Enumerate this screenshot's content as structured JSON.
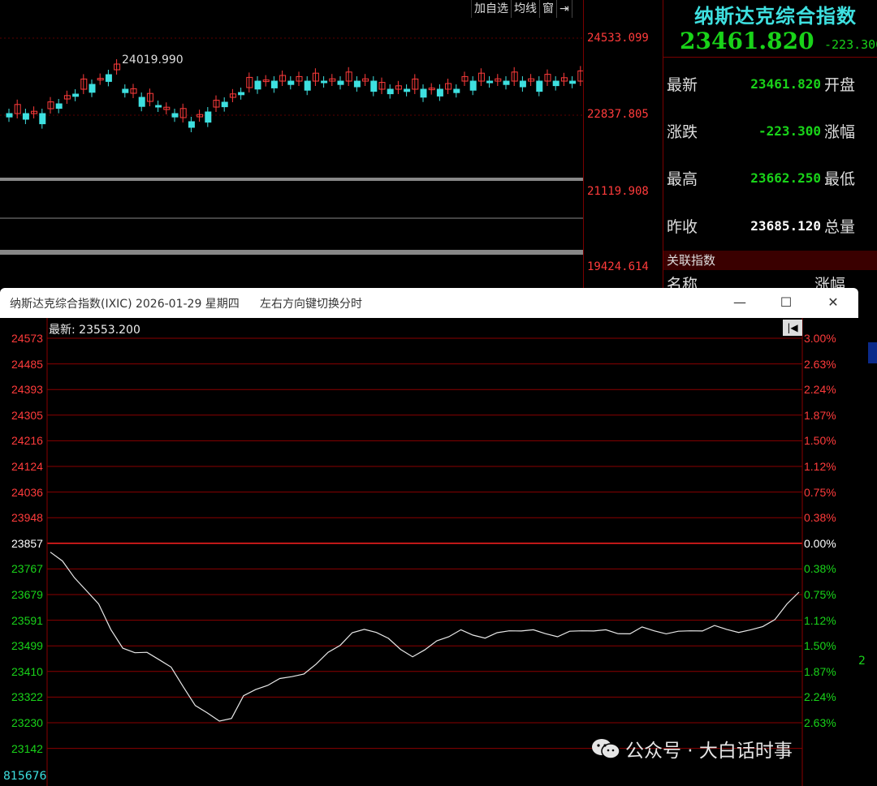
{
  "kline": {
    "toolbar": [
      "加自选",
      "均线",
      "窗",
      "⇥"
    ],
    "peak_label": "24019.990",
    "axis_labels": [
      "24533.099",
      "22837.805",
      "21119.908",
      "19424.614"
    ]
  },
  "quote": {
    "title": "纳斯达克综合指数",
    "price": "23461.820",
    "change": "-223.300",
    "rows": [
      {
        "label": "最新",
        "value": "23461.820",
        "label2": "开盘",
        "color": "#19d319"
      },
      {
        "label": "涨跌",
        "value": "-223.300",
        "label2": "涨幅",
        "color": "#19d319"
      },
      {
        "label": "最高",
        "value": "23662.250",
        "label2": "最低",
        "color": "#19d319"
      },
      {
        "label": "昨收",
        "value": "23685.120",
        "label2": "总量",
        "color": "#ffffff"
      }
    ],
    "related_header": "关联指数",
    "related_col1": "名称",
    "related_col2": "涨幅"
  },
  "popup": {
    "title": "纳斯达克综合指数(IXIC) 2026-01-29 星期四",
    "hint": "左右方向键切换分时",
    "latest": "最新: 23553.200",
    "min_icon": "minimize-icon",
    "max_icon": "maximize-icon",
    "close_icon": "close-icon",
    "y_labels": [
      {
        "v": "24573",
        "c": "#ff3b3b"
      },
      {
        "v": "24485",
        "c": "#ff3b3b"
      },
      {
        "v": "24393",
        "c": "#ff3b3b"
      },
      {
        "v": "24305",
        "c": "#ff3b3b"
      },
      {
        "v": "24216",
        "c": "#ff3b3b"
      },
      {
        "v": "24124",
        "c": "#ff3b3b"
      },
      {
        "v": "24036",
        "c": "#ff3b3b"
      },
      {
        "v": "23948",
        "c": "#ff3b3b"
      },
      {
        "v": "23857",
        "c": "#ffffff"
      },
      {
        "v": "23767",
        "c": "#19d319"
      },
      {
        "v": "23679",
        "c": "#19d319"
      },
      {
        "v": "23591",
        "c": "#19d319"
      },
      {
        "v": "23499",
        "c": "#19d319"
      },
      {
        "v": "23410",
        "c": "#19d319"
      },
      {
        "v": "23322",
        "c": "#19d319"
      },
      {
        "v": "23230",
        "c": "#19d319"
      },
      {
        "v": "23142",
        "c": "#19d319"
      }
    ],
    "pct_labels": [
      {
        "v": "3.00%",
        "c": "#ff3b3b"
      },
      {
        "v": "2.63%",
        "c": "#ff3b3b"
      },
      {
        "v": "2.24%",
        "c": "#ff3b3b"
      },
      {
        "v": "1.87%",
        "c": "#ff3b3b"
      },
      {
        "v": "1.50%",
        "c": "#ff3b3b"
      },
      {
        "v": "1.12%",
        "c": "#ff3b3b"
      },
      {
        "v": "0.75%",
        "c": "#ff3b3b"
      },
      {
        "v": "0.38%",
        "c": "#ff3b3b"
      },
      {
        "v": "0.00%",
        "c": "#ffffff"
      },
      {
        "v": "0.38%",
        "c": "#19d319"
      },
      {
        "v": "0.75%",
        "c": "#19d319"
      },
      {
        "v": "1.12%",
        "c": "#19d319"
      },
      {
        "v": "1.50%",
        "c": "#19d319"
      },
      {
        "v": "1.87%",
        "c": "#19d319"
      },
      {
        "v": "2.24%",
        "c": "#19d319"
      },
      {
        "v": "2.63%",
        "c": "#19d319"
      }
    ],
    "volume": "815676"
  },
  "intraday": [
    23835,
    23790,
    23740,
    23700,
    23640,
    23560,
    23500,
    23470,
    23480,
    23460,
    23420,
    23360,
    23300,
    23260,
    23240,
    23255,
    23320,
    23350,
    23370,
    23380,
    23395,
    23410,
    23430,
    23480,
    23510,
    23540,
    23560,
    23555,
    23520,
    23490,
    23470,
    23480,
    23520,
    23540,
    23550,
    23540,
    23535,
    23540,
    23555,
    23560,
    23550,
    23545,
    23540,
    23545,
    23555,
    23560,
    23550,
    23545,
    23550,
    23560,
    23555,
    23550,
    23545,
    23555,
    23560,
    23565,
    23560,
    23555,
    23550,
    23570,
    23600,
    23640,
    23690
  ],
  "watermark": {
    "text": "公众号 · 大白话时事",
    "icon": "wechat-icon"
  },
  "colors": {
    "up": "#ff3b3b",
    "down": "#19d319",
    "grid": "#8a0000",
    "cyan": "#3ee0e0"
  }
}
